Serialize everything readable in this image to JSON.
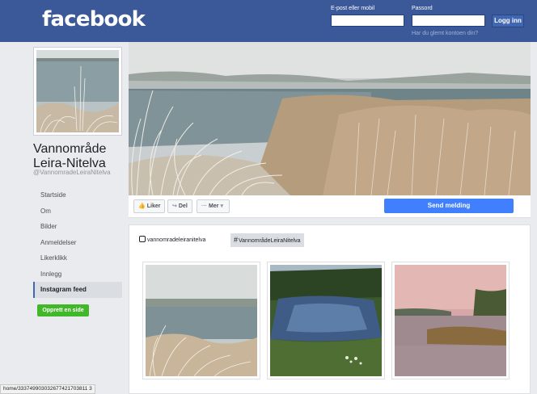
{
  "brand": {
    "logo_text": "facebook",
    "brand_color": "#3b5998"
  },
  "login": {
    "email_label": "E-post eller mobil",
    "password_label": "Passord",
    "login_button": "Logg inn",
    "forgot_link": "Har du glemt kontoen din?"
  },
  "page": {
    "name": "Vannområde Leira-Nitelva",
    "handle": "@VannomradeLeiraNitelva"
  },
  "nav": {
    "items": [
      {
        "label": "Startside"
      },
      {
        "label": "Om"
      },
      {
        "label": "Bilder"
      },
      {
        "label": "Anmeldelser"
      },
      {
        "label": "Likerklikk"
      },
      {
        "label": "Innlegg"
      },
      {
        "label": "Instagram feed",
        "active": true
      }
    ],
    "create_page": "Opprett en side"
  },
  "actions": {
    "like": "Liker",
    "share": "Del",
    "more": "Mer",
    "send_message": "Send melding"
  },
  "instagram": {
    "account_tab": "vannomradeleiranitelva",
    "hashtag_tab": "VannområdeLeiraNitelva",
    "photos": [
      "frost-lake",
      "green-pond",
      "sunset-lake"
    ]
  },
  "status_bar": {
    "url": "home/333749903032677421703811 3"
  }
}
